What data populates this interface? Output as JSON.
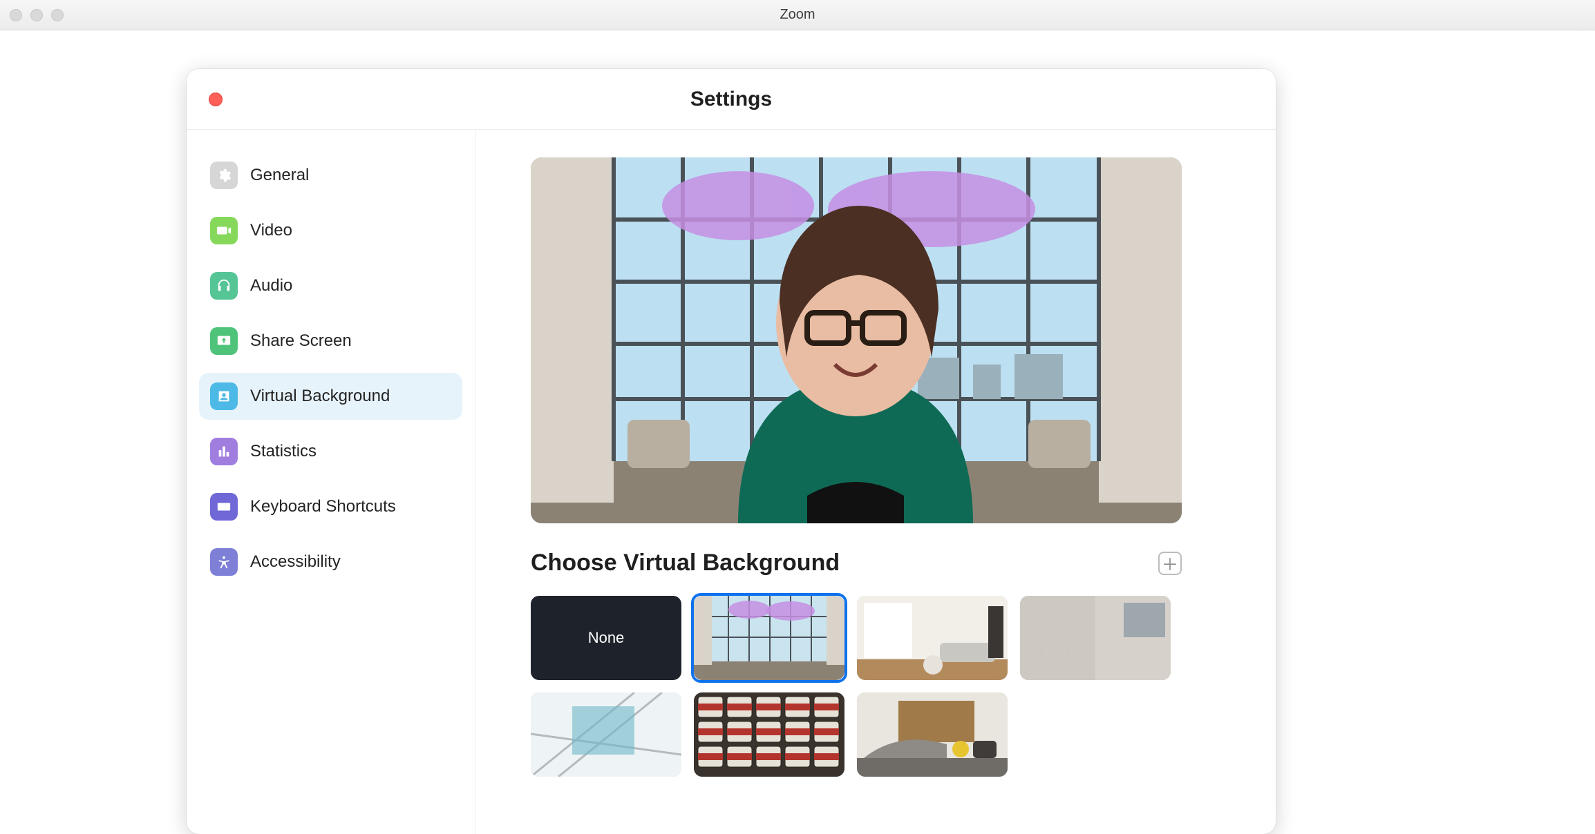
{
  "window": {
    "app_title": "Zoom"
  },
  "settings": {
    "title": "Settings",
    "close_icon": "close-dot"
  },
  "sidebar": {
    "items": [
      {
        "id": "general",
        "label": "General",
        "icon": "gear-icon",
        "color": "#d6d6d6"
      },
      {
        "id": "video",
        "label": "Video",
        "icon": "video-icon",
        "color": "#86d85b"
      },
      {
        "id": "audio",
        "label": "Audio",
        "icon": "headphones-icon",
        "color": "#56c596"
      },
      {
        "id": "share",
        "label": "Share Screen",
        "icon": "share-screen-icon",
        "color": "#4fc37a"
      },
      {
        "id": "vbg",
        "label": "Virtual Background",
        "icon": "virtual-background-icon",
        "color": "#4db9e6",
        "selected": true
      },
      {
        "id": "stats",
        "label": "Statistics",
        "icon": "statistics-icon",
        "color": "#a07ee0"
      },
      {
        "id": "shortcuts",
        "label": "Keyboard Shortcuts",
        "icon": "keyboard-icon",
        "color": "#6f68d6"
      },
      {
        "id": "a11y",
        "label": "Accessibility",
        "icon": "accessibility-icon",
        "color": "#7e80d7"
      }
    ]
  },
  "panel": {
    "section_title": "Choose Virtual Background",
    "add_icon": "plus-icon",
    "backgrounds": [
      {
        "id": "none",
        "label": "None",
        "type": "none"
      },
      {
        "id": "lobby",
        "label": "Lobby atrium",
        "type": "image",
        "selected": true
      },
      {
        "id": "living",
        "label": "Modern living room",
        "type": "image"
      },
      {
        "id": "wall",
        "label": "Concrete wall",
        "type": "image"
      },
      {
        "id": "ceiling",
        "label": "Glass ceiling",
        "type": "image"
      },
      {
        "id": "cans",
        "label": "Stacked cans",
        "type": "image"
      },
      {
        "id": "lounge",
        "label": "Office lounge",
        "type": "image"
      }
    ]
  }
}
